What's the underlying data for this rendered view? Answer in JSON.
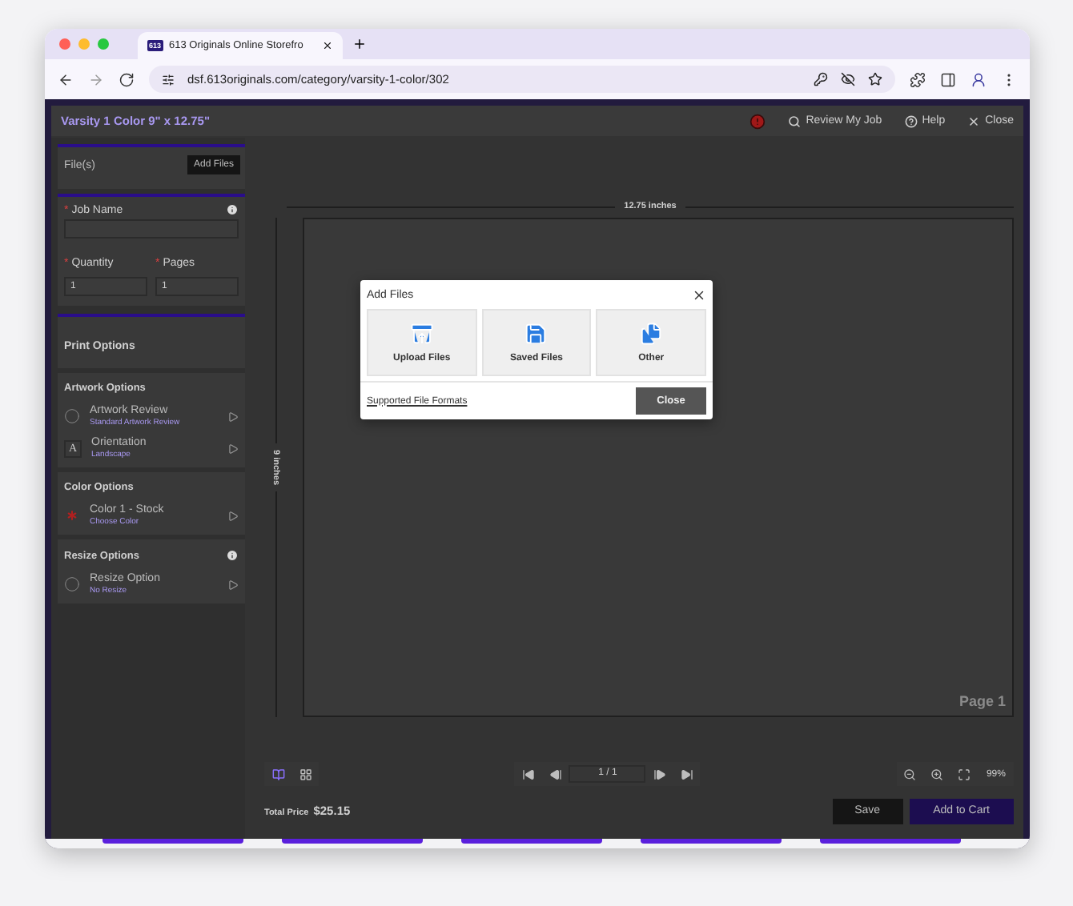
{
  "browser": {
    "tab_title": "613 Originals Online Storefro",
    "favicon_text": "613",
    "url": "dsf.613originals.com/category/varsity-1-color/302"
  },
  "app": {
    "title": "Varsity 1 Color 9\" x 12.75\"",
    "alert": true,
    "actions": [
      {
        "label": "Review My Job"
      },
      {
        "label": "Help"
      },
      {
        "label": "Close"
      }
    ]
  },
  "files": {
    "label": "File(s)",
    "button": "Add Files"
  },
  "job": {
    "fields": [
      {
        "label": "Job Name",
        "mark": "*",
        "info": true
      },
      {
        "label": "Quantity",
        "mark": "*",
        "value": "1"
      },
      {
        "label": "Pages",
        "mark": "*",
        "value": "1"
      }
    ]
  },
  "sections": [
    {
      "title": "Print Options",
      "kind": "heading"
    },
    {
      "title": "Artwork Options",
      "kind": "group",
      "info": false,
      "items": [
        {
          "title": "Artwork Review",
          "subtitle": "Standard Artwork Review",
          "kind": "radio"
        },
        {
          "title": "Orientation",
          "subtitle": "Landscape",
          "kind": "letter",
          "letter": "A"
        }
      ]
    },
    {
      "title": "Color Options",
      "kind": "group",
      "info": false,
      "items": [
        {
          "title": "Color 1 - Stock",
          "subtitle": "Choose Color",
          "kind": "color"
        }
      ]
    },
    {
      "title": "Resize Options",
      "kind": "group",
      "info": true,
      "items": [
        {
          "title": "Resize Option",
          "subtitle": "No Resize",
          "kind": "radio"
        }
      ]
    }
  ],
  "canvas": {
    "width_label": "12.75 inches",
    "height_label": "9 inches",
    "page_label": "Page 1"
  },
  "toolbar": {
    "views": [
      {
        "selected": true
      },
      {
        "selected": false
      }
    ],
    "page": "1 / 1",
    "zoom": "99%"
  },
  "footer": {
    "total_label": "Total Price",
    "total": "$25.15",
    "buttons": [
      {
        "label": "Save",
        "kind": "secondary"
      },
      {
        "label": "Add to Cart",
        "kind": "primary"
      }
    ]
  },
  "dialog": {
    "title": "Add Files",
    "options": [
      {
        "label": "Upload Files"
      },
      {
        "label": "Saved Files"
      },
      {
        "label": "Other"
      }
    ],
    "link": "Supported File Formats",
    "button": "Close"
  }
}
